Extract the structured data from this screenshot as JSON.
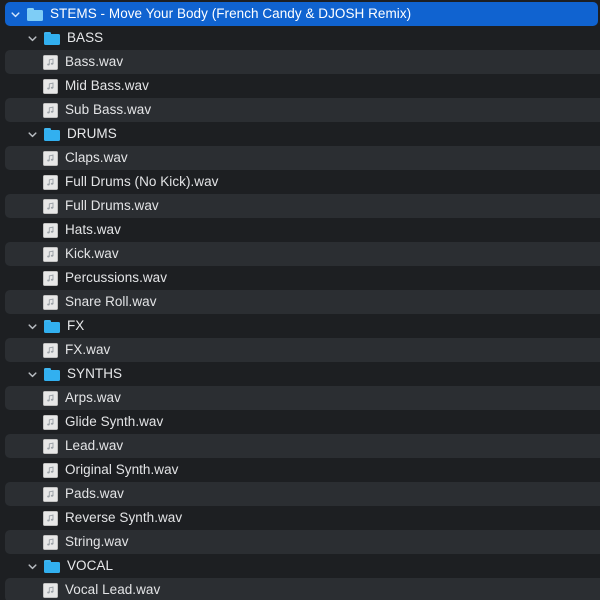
{
  "window": {
    "type": "file-tree-browser",
    "theme": "dark",
    "colors": {
      "background": "#1d1f22",
      "row_alt": "#2b2e32",
      "selection": "#1063d0",
      "folder_icon": "#32b0f0",
      "file_icon": "#e7e7e7",
      "text": "#e3e4e6",
      "text_selected": "#ffffff"
    }
  },
  "icons": {
    "chevron_expanded": "chevron-down-icon",
    "folder": "folder-icon",
    "audio_file": "music-note-file-icon"
  },
  "tree": {
    "root": {
      "label": "STEMS - Move Your Body (French Candy & DJOSH Remix)",
      "type": "folder",
      "expanded": true,
      "selected": true
    },
    "rows": [
      {
        "label": "STEMS - Move Your Body (French Candy & DJOSH Remix)",
        "type": "folder",
        "depth": 0,
        "expanded": true,
        "selected": true,
        "alt": false
      },
      {
        "label": "BASS",
        "type": "folder",
        "depth": 1,
        "expanded": true,
        "selected": false,
        "alt": false
      },
      {
        "label": "Bass.wav",
        "type": "file",
        "depth": 2,
        "expanded": false,
        "selected": false,
        "alt": true
      },
      {
        "label": "Mid Bass.wav",
        "type": "file",
        "depth": 2,
        "expanded": false,
        "selected": false,
        "alt": false
      },
      {
        "label": "Sub Bass.wav",
        "type": "file",
        "depth": 2,
        "expanded": false,
        "selected": false,
        "alt": true
      },
      {
        "label": "DRUMS",
        "type": "folder",
        "depth": 1,
        "expanded": true,
        "selected": false,
        "alt": false
      },
      {
        "label": "Claps.wav",
        "type": "file",
        "depth": 2,
        "expanded": false,
        "selected": false,
        "alt": true
      },
      {
        "label": "Full Drums (No Kick).wav",
        "type": "file",
        "depth": 2,
        "expanded": false,
        "selected": false,
        "alt": false
      },
      {
        "label": "Full Drums.wav",
        "type": "file",
        "depth": 2,
        "expanded": false,
        "selected": false,
        "alt": true
      },
      {
        "label": "Hats.wav",
        "type": "file",
        "depth": 2,
        "expanded": false,
        "selected": false,
        "alt": false
      },
      {
        "label": "Kick.wav",
        "type": "file",
        "depth": 2,
        "expanded": false,
        "selected": false,
        "alt": true
      },
      {
        "label": "Percussions.wav",
        "type": "file",
        "depth": 2,
        "expanded": false,
        "selected": false,
        "alt": false
      },
      {
        "label": "Snare Roll.wav",
        "type": "file",
        "depth": 2,
        "expanded": false,
        "selected": false,
        "alt": true
      },
      {
        "label": "FX",
        "type": "folder",
        "depth": 1,
        "expanded": true,
        "selected": false,
        "alt": false
      },
      {
        "label": "FX.wav",
        "type": "file",
        "depth": 2,
        "expanded": false,
        "selected": false,
        "alt": true
      },
      {
        "label": "SYNTHS",
        "type": "folder",
        "depth": 1,
        "expanded": true,
        "selected": false,
        "alt": false
      },
      {
        "label": "Arps.wav",
        "type": "file",
        "depth": 2,
        "expanded": false,
        "selected": false,
        "alt": true
      },
      {
        "label": "Glide Synth.wav",
        "type": "file",
        "depth": 2,
        "expanded": false,
        "selected": false,
        "alt": false
      },
      {
        "label": "Lead.wav",
        "type": "file",
        "depth": 2,
        "expanded": false,
        "selected": false,
        "alt": true
      },
      {
        "label": "Original Synth.wav",
        "type": "file",
        "depth": 2,
        "expanded": false,
        "selected": false,
        "alt": false
      },
      {
        "label": "Pads.wav",
        "type": "file",
        "depth": 2,
        "expanded": false,
        "selected": false,
        "alt": true
      },
      {
        "label": "Reverse Synth.wav",
        "type": "file",
        "depth": 2,
        "expanded": false,
        "selected": false,
        "alt": false
      },
      {
        "label": "String.wav",
        "type": "file",
        "depth": 2,
        "expanded": false,
        "selected": false,
        "alt": true
      },
      {
        "label": "VOCAL",
        "type": "folder",
        "depth": 1,
        "expanded": true,
        "selected": false,
        "alt": false
      },
      {
        "label": "Vocal Lead.wav",
        "type": "file",
        "depth": 2,
        "expanded": false,
        "selected": false,
        "alt": true
      }
    ]
  }
}
